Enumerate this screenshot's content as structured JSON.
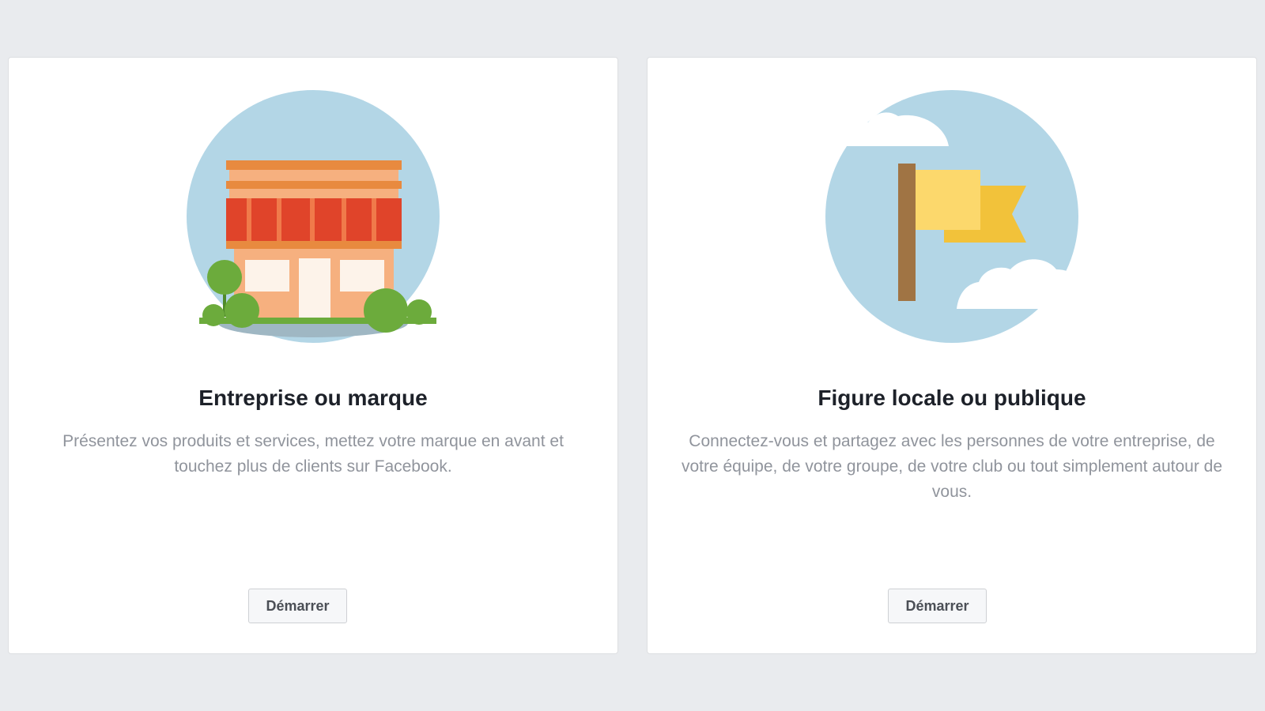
{
  "cards": [
    {
      "icon": "storefront-icon",
      "title": "Entreprise ou marque",
      "description": "Présentez vos produits et services, mettez votre marque en avant et touchez plus de clients sur Facebook.",
      "button_label": "Démarrer"
    },
    {
      "icon": "flag-icon",
      "title": "Figure locale ou publique",
      "description": "Connectez-vous et partagez avec les personnes de votre entreprise, de votre équipe, de votre groupe, de votre club ou tout simplement autour de vous.",
      "button_label": "Démarrer"
    }
  ],
  "colors": {
    "background": "#e9ebee",
    "card": "#ffffff",
    "sky": "#b3d6e6",
    "awning": "#e0442a",
    "building": "#f6b07f",
    "roof": "#e88a3f",
    "tree": "#6cab3c",
    "flag": "#fcd86c",
    "flag_shadow": "#f2c23a",
    "pole": "#a07444",
    "title": "#1d2129",
    "description": "#90949c"
  }
}
